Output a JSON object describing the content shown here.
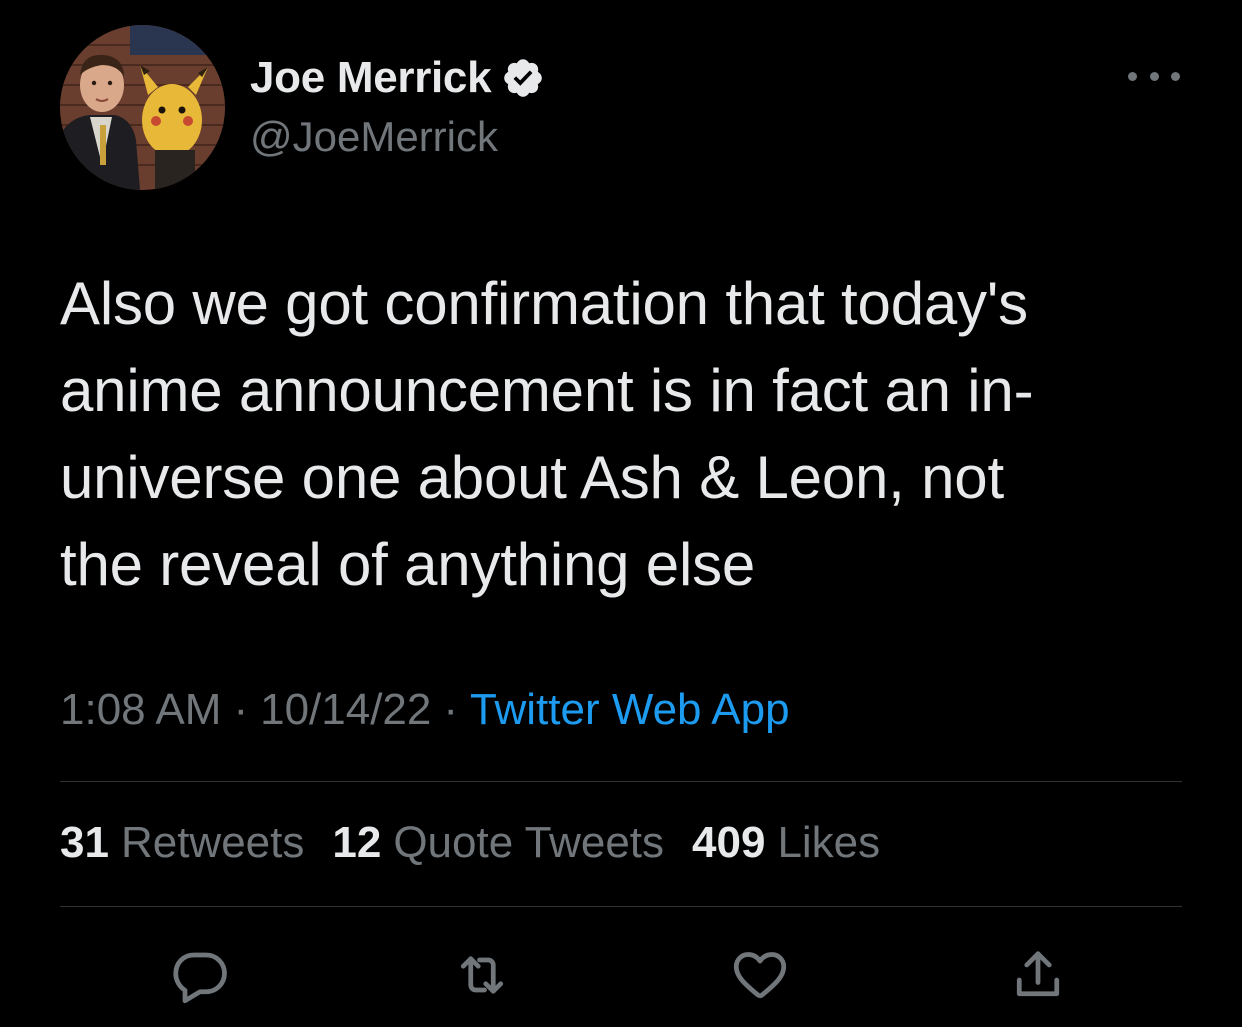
{
  "author": {
    "display_name": "Joe Merrick",
    "handle": "@JoeMerrick",
    "verified": true,
    "avatar_icon": "profile-photo"
  },
  "tweet": {
    "text": "Also we got confirmation that today's\nanime announcement is in fact an in-\nuniverse one about Ash & Leon, not\nthe reveal of anything else",
    "time": "1:08 AM",
    "separator": "·",
    "date": "10/14/22",
    "source": "Twitter Web App"
  },
  "stats": {
    "retweets_count": "31",
    "retweets_label": "Retweets",
    "quotes_count": "12",
    "quotes_label": "Quote Tweets",
    "likes_count": "409",
    "likes_label": "Likes"
  },
  "actions": [
    {
      "name": "reply",
      "icon": "reply-icon"
    },
    {
      "name": "retweet",
      "icon": "retweet-icon"
    },
    {
      "name": "like",
      "icon": "heart-icon"
    },
    {
      "name": "share",
      "icon": "share-icon"
    }
  ],
  "colors": {
    "background": "#000000",
    "text_primary": "#e7e9ea",
    "text_secondary": "#71767b",
    "accent": "#1d9bf0",
    "divider": "#2f3336"
  }
}
